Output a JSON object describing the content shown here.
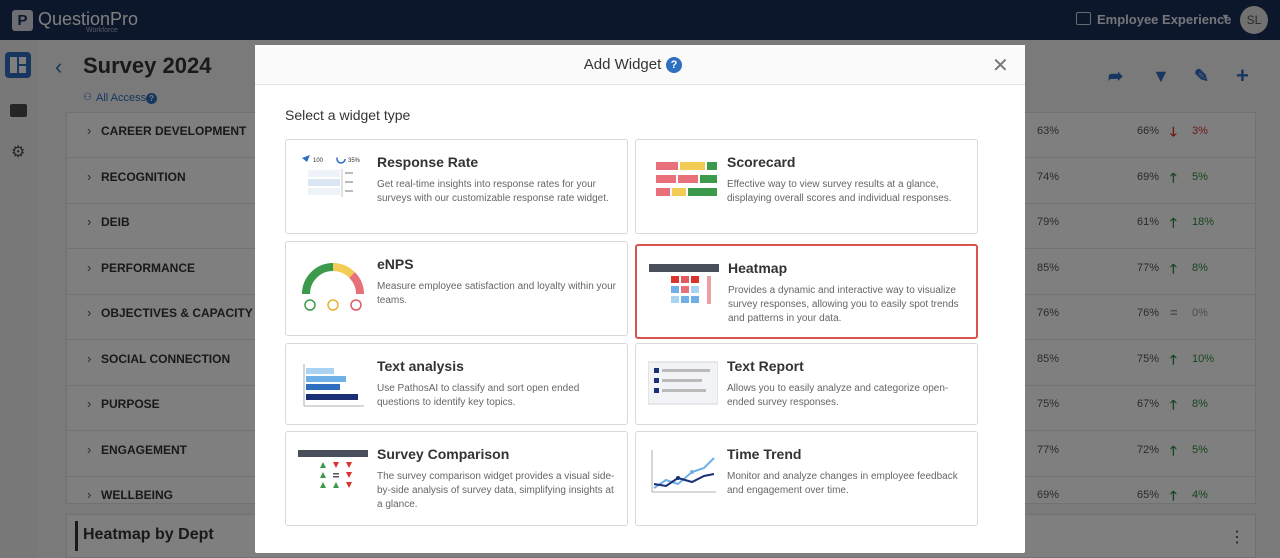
{
  "topbar": {
    "logo_letter": "P",
    "brand": "QuestionPro",
    "brand_sub": "Workforce",
    "product": "Employee Experience",
    "avatar": "SL"
  },
  "page": {
    "title": "Survey 2024",
    "access": "All Access"
  },
  "rows": [
    {
      "label": "CAREER DEVELOPMENT",
      "v1": "63%",
      "v2": "66%",
      "trend": "down",
      "arrow": "🡓",
      "delta": "3%"
    },
    {
      "label": "RECOGNITION",
      "v1": "74%",
      "v2": "69%",
      "trend": "up",
      "arrow": "🡑",
      "delta": "5%"
    },
    {
      "label": "DEIB",
      "v1": "79%",
      "v2": "61%",
      "trend": "up",
      "arrow": "🡑",
      "delta": "18%"
    },
    {
      "label": "PERFORMANCE",
      "v1": "85%",
      "v2": "77%",
      "trend": "up",
      "arrow": "🡑",
      "delta": "8%"
    },
    {
      "label": "OBJECTIVES & CAPACITY",
      "v1": "76%",
      "v2": "76%",
      "trend": "flat",
      "arrow": "=",
      "delta": "0%"
    },
    {
      "label": "SOCIAL CONNECTION",
      "v1": "85%",
      "v2": "75%",
      "trend": "up",
      "arrow": "🡑",
      "delta": "10%"
    },
    {
      "label": "PURPOSE",
      "v1": "75%",
      "v2": "67%",
      "trend": "up",
      "arrow": "🡑",
      "delta": "8%"
    },
    {
      "label": "ENGAGEMENT",
      "v1": "77%",
      "v2": "72%",
      "trend": "up",
      "arrow": "🡑",
      "delta": "5%"
    },
    {
      "label": "WELLBEING",
      "v1": "69%",
      "v2": "65%",
      "trend": "up",
      "arrow": "🡑",
      "delta": "4%"
    }
  ],
  "bottom_card": {
    "title": "Heatmap by Dept"
  },
  "modal": {
    "title": "Add Widget",
    "subtitle": "Select a widget type",
    "widgets": [
      {
        "title": "Response Rate",
        "desc": "Get real-time insights into response rates for your surveys with our customizable response rate widget.",
        "ill_a": "100",
        "ill_b": "35%"
      },
      {
        "title": "Scorecard",
        "desc": "Effective way to view survey results at a glance, displaying overall scores and individual responses."
      },
      {
        "title": "eNPS",
        "desc": "Measure employee satisfaction and loyalty within your teams."
      },
      {
        "title": "Heatmap",
        "desc": "Provides a dynamic and interactive way to visualize survey responses, allowing you to easily spot trends and patterns in your data.",
        "selected": true
      },
      {
        "title": "Text analysis",
        "desc": "Use PathosAI to classify and sort open ended questions to identify key topics."
      },
      {
        "title": "Text Report",
        "desc": "Allows you to easily analyze and categorize open-ended survey responses."
      },
      {
        "title": "Survey Comparison",
        "desc": "The survey comparison widget provides a visual side-by-side analysis of survey data, simplifying insights at a glance."
      },
      {
        "title": "Time Trend",
        "desc": "Monitor and analyze changes in employee feedback and engagement over time."
      }
    ]
  },
  "colors": {
    "navy": "#1b2f57",
    "accent": "#2f6fc0",
    "up": "#2e8b3a",
    "down": "#d9342b",
    "selected": "#d9534f"
  }
}
